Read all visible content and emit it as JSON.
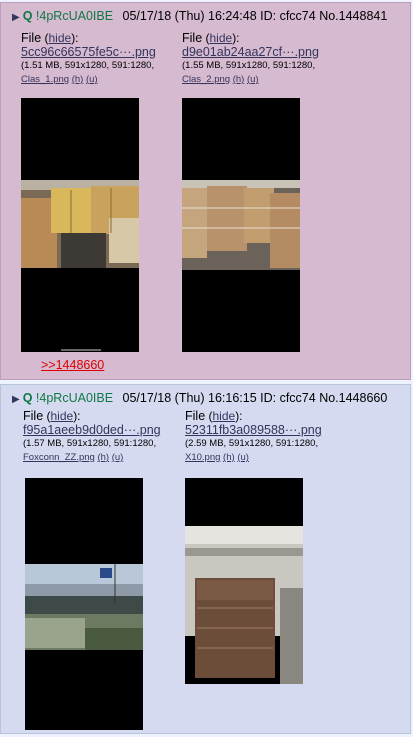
{
  "post1": {
    "trip": "!4pRcUA0IBE",
    "datetime": "05/17/18 (Thu) 16:24:48",
    "id": "ID: cfcc74",
    "number": "No.1448841",
    "files": [
      {
        "label": "File",
        "hide": "hide",
        "name": "5cc96c66575fe5c···.png",
        "info": "(1.51 MB, 591x1280, 591:1280,",
        "orig": "Clas_1.png",
        "h": "(h)",
        "u": "(u)"
      },
      {
        "label": "File",
        "hide": "hide",
        "name": "d9e01ab24aa27cf···.png",
        "info": "(1.55 MB, 591x1280, 591:1280,",
        "orig": "Clas_2.png",
        "h": "(h)",
        "u": "(u)"
      }
    ],
    "backlink": ">>1448660"
  },
  "post2": {
    "trip": "!4pRcUA0IBE",
    "datetime": "05/17/18 (Thu) 16:16:15",
    "id": "ID: cfcc74",
    "number": "No.1448660",
    "files": [
      {
        "label": "File",
        "hide": "hide",
        "name": "f95a1aeeb9d0ded···.png",
        "info": "(1.57 MB, 591x1280, 591:1280,",
        "orig": "Foxconn_ZZ.png",
        "h": "(h)",
        "u": "(u)"
      },
      {
        "label": "File",
        "hide": "hide",
        "name": "52311fb3a089588···.png",
        "info": "(2.59 MB, 591x1280, 591:1280,",
        "orig": "X10.png",
        "h": "(h)",
        "u": "(u)"
      }
    ]
  },
  "icons": {
    "expand": "triangle-expand-icon",
    "q": "q-mark-icon"
  },
  "colors": {
    "highlight_bg": "#d6bad0",
    "reply_bg": "#d6daf0",
    "trip": "#117743",
    "link": "#34345c",
    "backlink": "#dd0000"
  }
}
